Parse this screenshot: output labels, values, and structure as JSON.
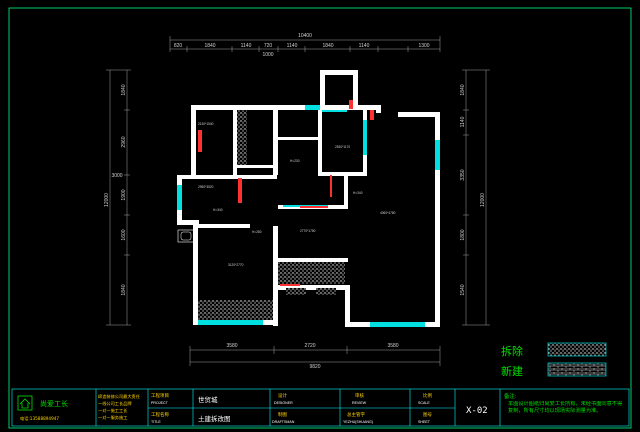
{
  "dimensions": {
    "top_total": "10400",
    "top_segments": [
      "820",
      "1840",
      "1140",
      "720",
      "1140",
      "1840",
      "1140",
      "1300"
    ],
    "top_small": "1000",
    "left_total": "12000",
    "left_mid": "3000",
    "left_segments": [
      "1840",
      "2960",
      "1900",
      "1600",
      "1840"
    ],
    "right_total": "12000",
    "right_segments": [
      "1840",
      "1140",
      "3350",
      "1800",
      "1540"
    ],
    "bottom_segments": [
      "3580",
      "2720",
      "3580"
    ],
    "bottom_total": "9820"
  },
  "rooms": {
    "h1": "H=230",
    "h2": "H=340",
    "h3": "H=340",
    "h4": "H=280",
    "r1": "2530*1170",
    "r2": "2950*3520",
    "r3": "4060*4780",
    "r4": "2770*1750",
    "r5": "3120*2770",
    "r6": "2130*1540",
    "sub": "32"
  },
  "legend": {
    "demolish": "拆除",
    "new_build": "新建"
  },
  "title_block": {
    "company": "尚爱工长",
    "phone": "电话:13588894947",
    "slogans": [
      "缔造装修公司最大责任",
      "一线公司工长品牌",
      "一对一施工工长",
      "一对一服务施工"
    ],
    "project_label": "工程项目",
    "project_en": "PROJECT",
    "project_value": "世贸城",
    "drawing_label": "工程名称",
    "drawing_en": "TITLE",
    "drawing_value": "土建拆改图",
    "design_label": "设计",
    "design_en": "DESIGNER",
    "draw_label": "制图",
    "draw_en": "DRAFTSMAN",
    "review_label": "审核",
    "review_en": "REVIEW",
    "director_label": "总主管字",
    "director_en": "YEZHU(SHUANG)",
    "scale_label": "比例",
    "scale_en": "SCALE",
    "sheet_label": "图号",
    "sheet_en": "SHEET",
    "drawing_no": "X-02",
    "note_label": "备注:",
    "note_text": "本图设计图纸归尚爱工长所有，未经书面同意不得复制，所有尺寸均以现场实际测量为准。"
  },
  "colors": {
    "wall": "#ffffff",
    "frame": "#00ff80",
    "window": "#00e0e0",
    "door_red": "#ff3030",
    "tb_line": "#00ffff",
    "yellow": "#ffd200",
    "green": "#00e000"
  }
}
